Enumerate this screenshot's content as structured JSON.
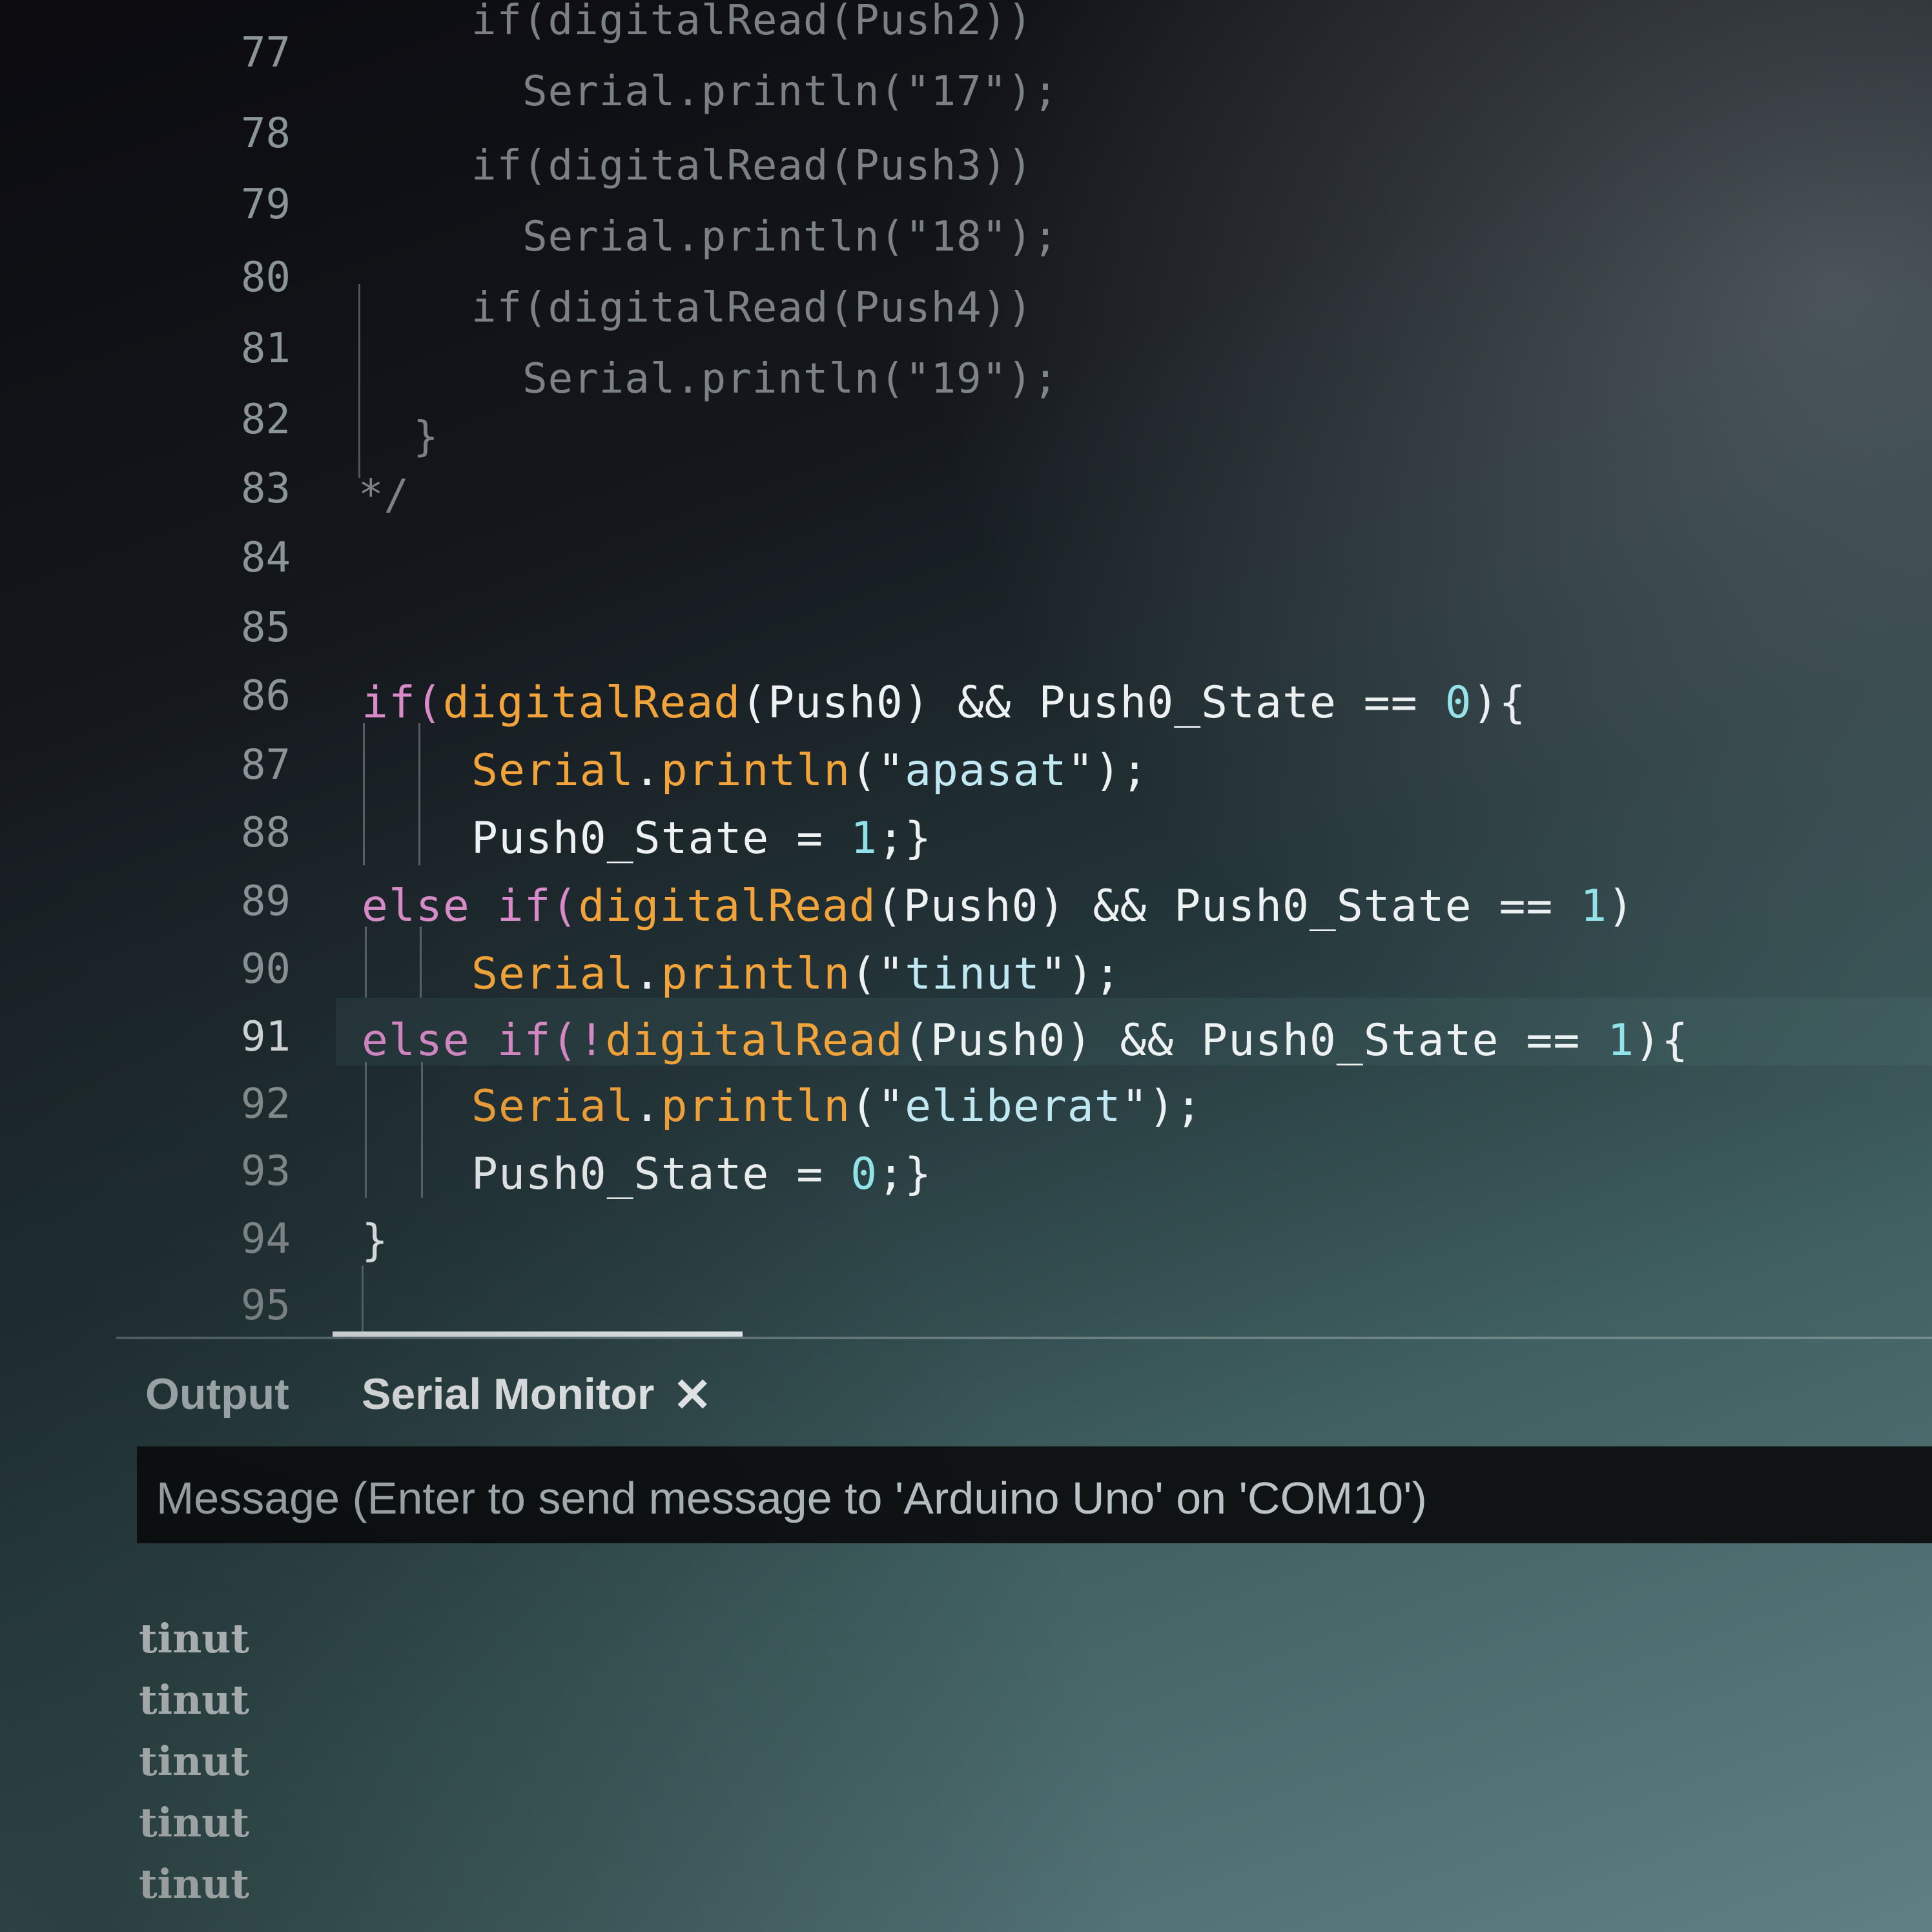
{
  "editor": {
    "line_numbers": [
      "77",
      "78",
      "79",
      "80",
      "81",
      "82",
      "83",
      "84",
      "85",
      "86",
      "87",
      "88",
      "89",
      "90",
      "91",
      "92",
      "93",
      "94",
      "95"
    ],
    "active_line": "91",
    "faint_lines": [
      {
        "tokens": [
          [
            "cmt",
            "if(digitalRead(Push2))"
          ]
        ]
      },
      {
        "tokens": [
          [
            "cmt",
            "  Serial.println(\"17\");"
          ]
        ]
      },
      {
        "tokens": [
          [
            "cmt",
            "if(digitalRead(Push3))"
          ]
        ]
      },
      {
        "tokens": [
          [
            "cmt",
            "  Serial.println(\"18\");"
          ]
        ]
      },
      {
        "tokens": [
          [
            "cmt",
            "if(digitalRead(Push4))"
          ]
        ]
      },
      {
        "tokens": [
          [
            "cmt",
            "  Serial.println(\"19\");"
          ]
        ]
      },
      {
        "tokens": [
          [
            "cmt",
            "}"
          ]
        ]
      },
      {
        "tokens": [
          [
            "cmt",
            "*/"
          ]
        ]
      }
    ],
    "code_lines": [
      {
        "line": "86",
        "tokens": [
          [
            "kw",
            "if("
          ],
          [
            "fn",
            "digitalRead"
          ],
          [
            "pun",
            "(Push0) && Push0_State == "
          ],
          [
            "num",
            "0"
          ],
          [
            "pun",
            "){"
          ]
        ]
      },
      {
        "line": "87",
        "tokens": [
          [
            "fn",
            "Serial"
          ],
          [
            "pun",
            "."
          ],
          [
            "fn",
            "println"
          ],
          [
            "pun",
            "(\""
          ],
          [
            "str",
            "apasat"
          ],
          [
            "pun",
            "\");"
          ]
        ]
      },
      {
        "line": "88",
        "tokens": [
          [
            "id",
            "Push0_State = "
          ],
          [
            "num",
            "1"
          ],
          [
            "pun",
            ";}"
          ]
        ]
      },
      {
        "line": "89",
        "tokens": [
          [
            "kw",
            "else if("
          ],
          [
            "fn",
            "digitalRead"
          ],
          [
            "pun",
            "(Push0) && Push0_State == "
          ],
          [
            "num",
            "1"
          ],
          [
            "pun",
            ")"
          ]
        ]
      },
      {
        "line": "90",
        "tokens": [
          [
            "fn",
            "Serial"
          ],
          [
            "pun",
            "."
          ],
          [
            "fn",
            "println"
          ],
          [
            "pun",
            "(\""
          ],
          [
            "str",
            "tinut"
          ],
          [
            "pun",
            "\");"
          ]
        ]
      },
      {
        "line": "91",
        "tokens": [
          [
            "kw",
            "else if(!"
          ],
          [
            "fn",
            "digitalRead"
          ],
          [
            "pun",
            "(Push0) && Push0_State == "
          ],
          [
            "num",
            "1"
          ],
          [
            "pun",
            "){"
          ]
        ]
      },
      {
        "line": "92",
        "tokens": [
          [
            "fn",
            "Serial"
          ],
          [
            "pun",
            "."
          ],
          [
            "fn",
            "println"
          ],
          [
            "pun",
            "(\""
          ],
          [
            "str",
            "eliberat"
          ],
          [
            "pun",
            "\");"
          ]
        ]
      },
      {
        "line": "93",
        "tokens": [
          [
            "id",
            "Push0_State = "
          ],
          [
            "num",
            "0"
          ],
          [
            "pun",
            ";}"
          ]
        ]
      },
      {
        "line": "94",
        "tokens": [
          [
            "pun",
            "}"
          ]
        ]
      }
    ]
  },
  "panel": {
    "tabs": [
      {
        "label": "Output"
      },
      {
        "label": "Serial Monitor"
      }
    ],
    "close_glyph": "✕",
    "message_placeholder": "Message (Enter to send message to 'Arduino Uno' on 'COM10')",
    "serial_output": [
      "tinut",
      "tinut",
      "tinut",
      "tinut",
      "tinut"
    ]
  },
  "colors": {
    "keyword": "#d88bc8",
    "function": "#f2a33a",
    "string": "#bfe8f2",
    "number": "#8fe3e8",
    "identifier": "#eef1f2"
  }
}
